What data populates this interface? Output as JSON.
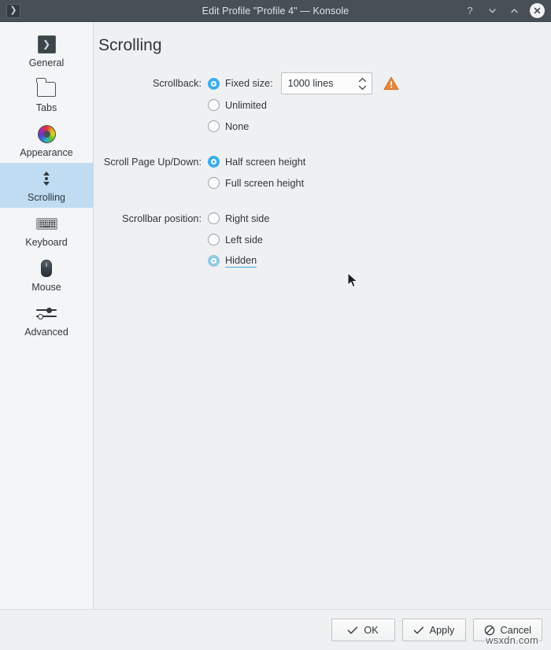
{
  "window": {
    "title": "Edit Profile \"Profile 4\" — Konsole",
    "app_icon": "konsole-icon",
    "controls": {
      "help": "?",
      "minimize": "minimize-icon",
      "maximize": "maximize-icon",
      "close": "close-icon"
    },
    "accent_color": "#3daee9",
    "titlebar_color": "#475057",
    "background_color": "#eff0f1"
  },
  "sidebar": {
    "items": [
      {
        "label": "General",
        "icon": "konsole-terminal-icon",
        "selected": false
      },
      {
        "label": "Tabs",
        "icon": "tab-folder-icon",
        "selected": false
      },
      {
        "label": "Appearance",
        "icon": "color-wheel-icon",
        "selected": false
      },
      {
        "label": "Scrolling",
        "icon": "scrollbar-icon",
        "selected": true
      },
      {
        "label": "Keyboard",
        "icon": "keyboard-icon",
        "selected": false
      },
      {
        "label": "Mouse",
        "icon": "mouse-icon",
        "selected": false
      },
      {
        "label": "Advanced",
        "icon": "sliders-icon",
        "selected": false
      }
    ],
    "selected_background": "#bfdcf2"
  },
  "main": {
    "page_title": "Scrolling",
    "groups": [
      {
        "label": "Scrollback:",
        "options": [
          {
            "label": "Fixed size:",
            "selected": true,
            "hover": false
          },
          {
            "label": "Unlimited",
            "selected": false,
            "hover": false
          },
          {
            "label": "None",
            "selected": false,
            "hover": false
          }
        ]
      },
      {
        "label": "Scroll Page Up/Down:",
        "options": [
          {
            "label": "Half screen height",
            "selected": true,
            "hover": false
          },
          {
            "label": "Full screen height",
            "selected": false,
            "hover": false
          }
        ]
      },
      {
        "label": "Scrollbar position:",
        "options": [
          {
            "label": "Right side",
            "selected": false,
            "hover": false
          },
          {
            "label": "Left side",
            "selected": false,
            "hover": false
          },
          {
            "label": "Hidden",
            "selected": true,
            "hover": true
          }
        ]
      }
    ],
    "scrollback_spinbox": {
      "value": "1000 lines",
      "up_icon": "chevron-up-icon",
      "down_icon": "chevron-down-icon"
    },
    "scrollback_warning": {
      "icon": "warning-triangle-icon",
      "color": "#e8883a"
    }
  },
  "footer": {
    "buttons": [
      {
        "label": "OK",
        "icon": "check-icon"
      },
      {
        "label": "Apply",
        "icon": "check-icon"
      },
      {
        "label": "Cancel",
        "icon": "prohibition-icon"
      }
    ]
  },
  "overlay": {
    "cursor_icon": "mouse-pointer-icon",
    "watermark": "wsxdn.com"
  }
}
